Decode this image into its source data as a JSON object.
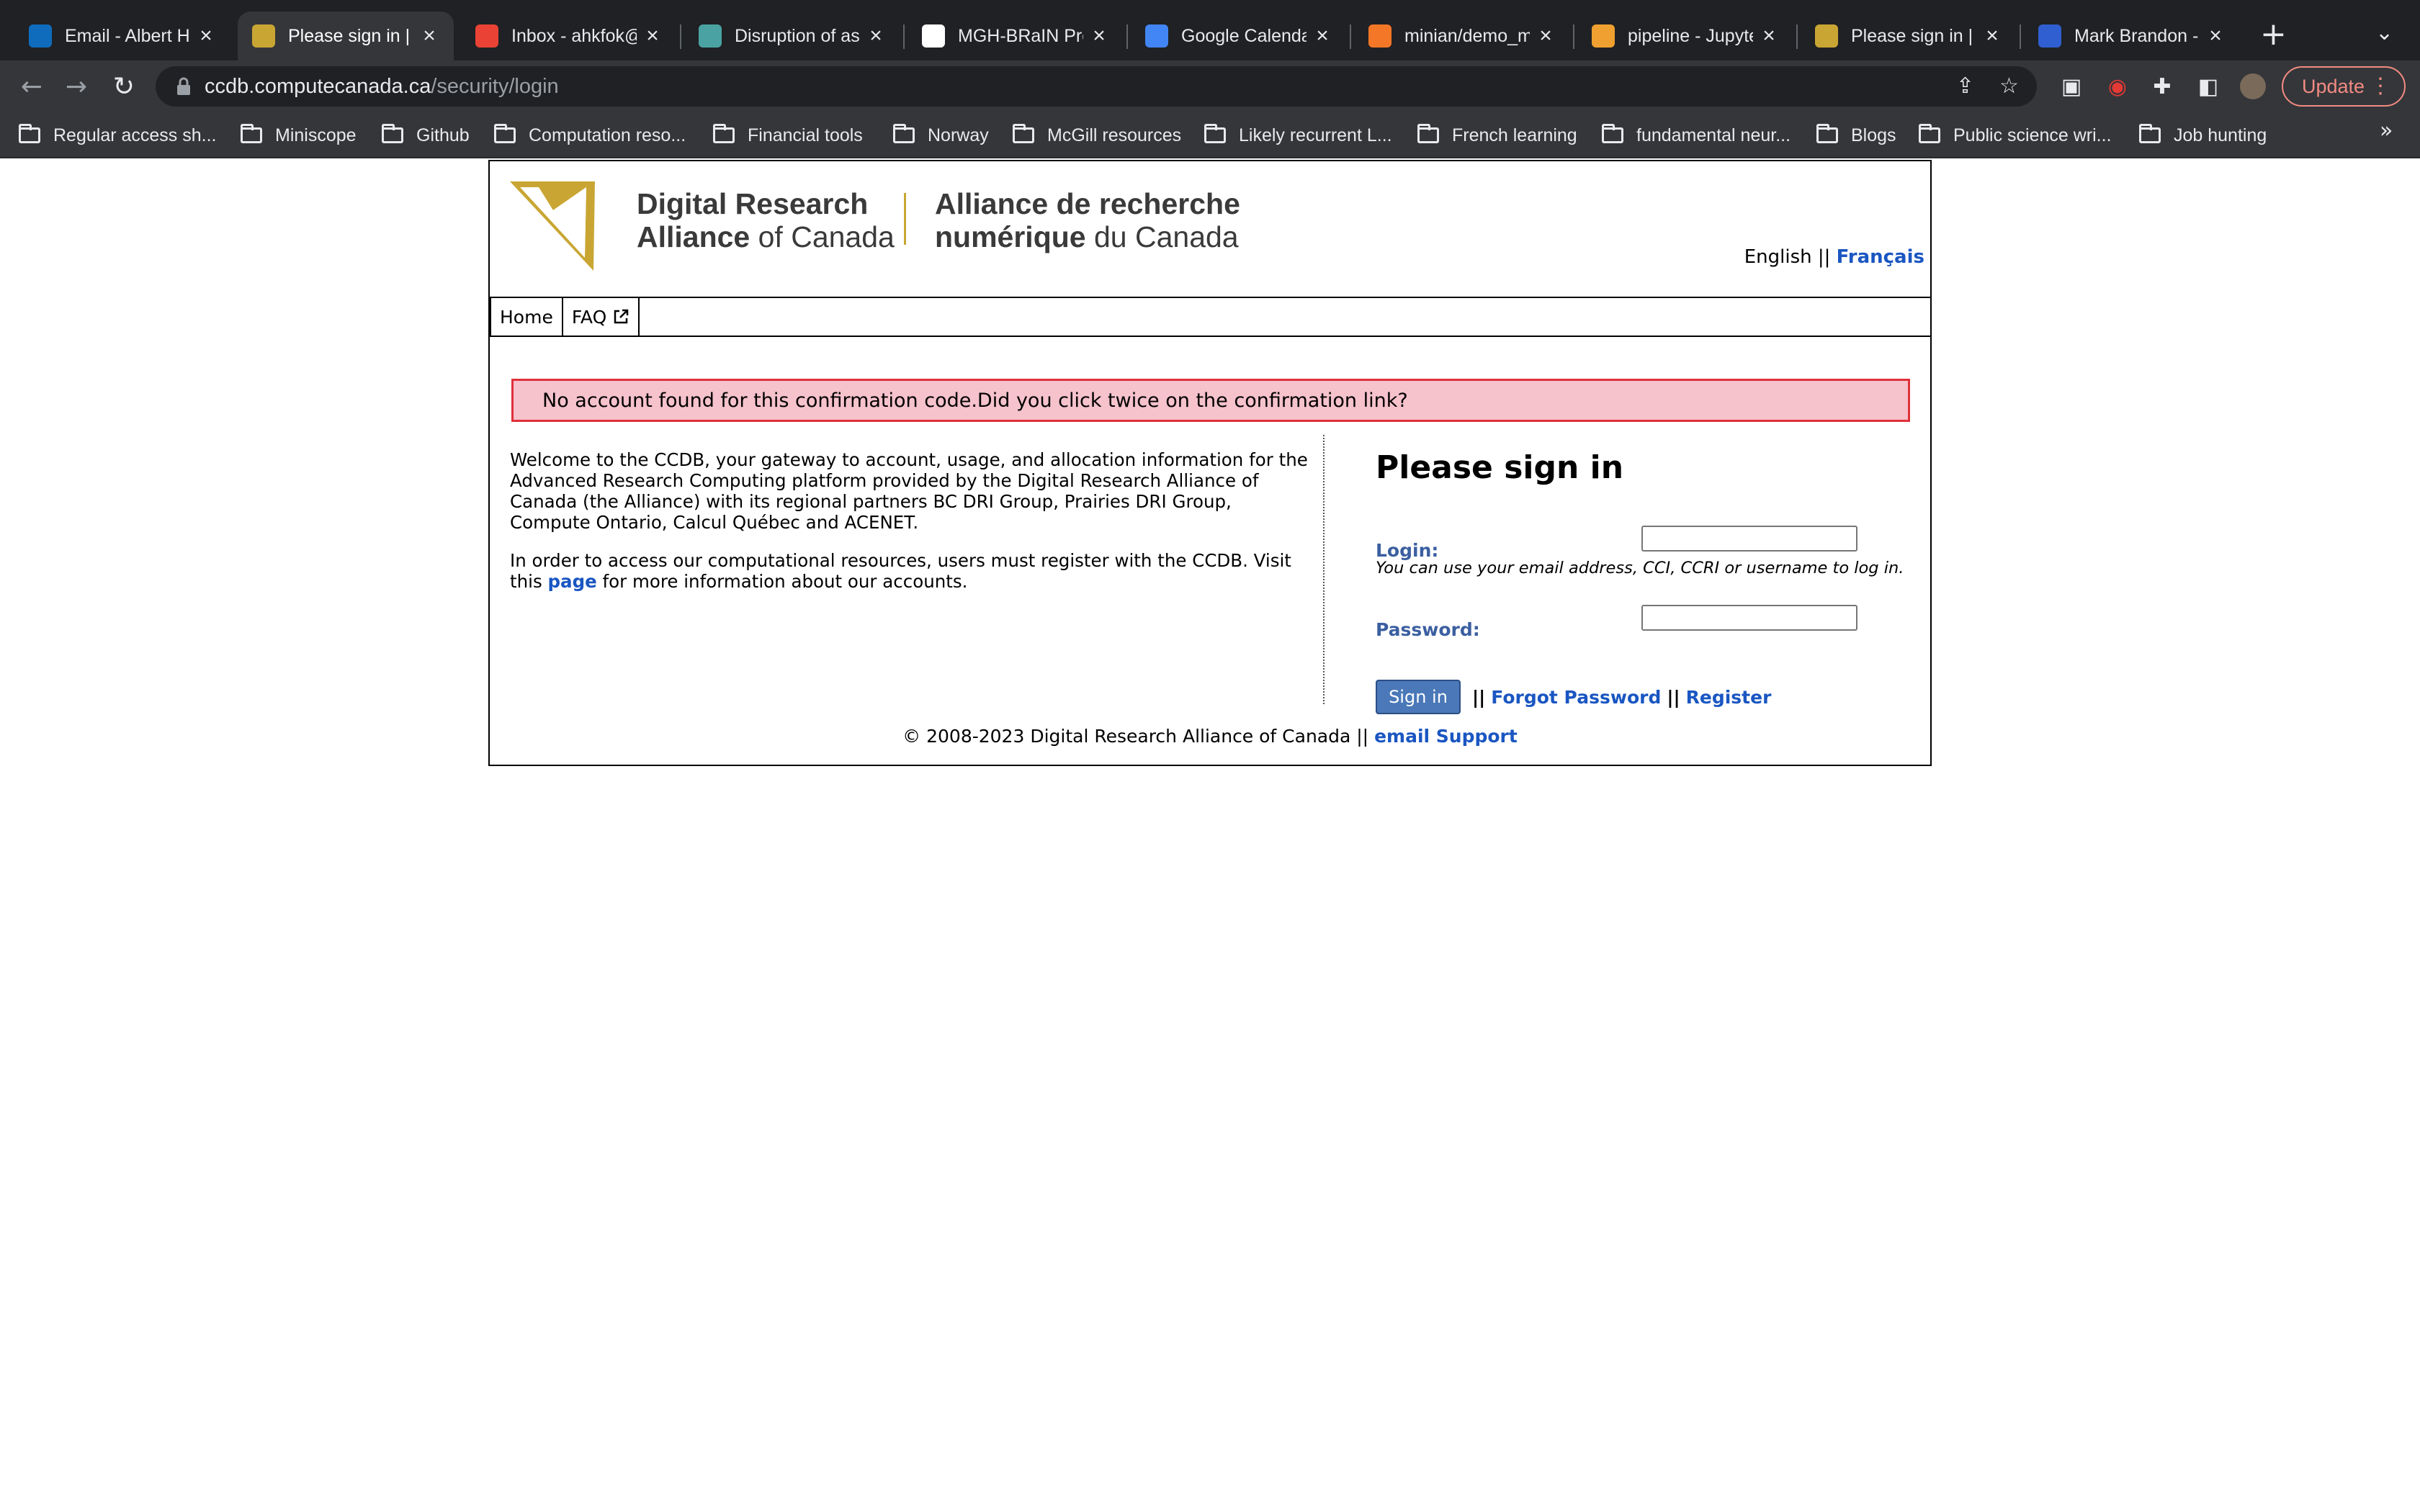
{
  "browser": {
    "tabs": [
      {
        "title": "Email - Albert H",
        "favicon": "outlook-icon",
        "color": "#0f6cbd"
      },
      {
        "title": "Please sign in | C",
        "favicon": "ccdb-icon",
        "color": "#c9a633",
        "active": true
      },
      {
        "title": "Inbox - ahkfok@",
        "favicon": "gmail-icon",
        "color": "#ea4335"
      },
      {
        "title": "Disruption of as",
        "favicon": "paper-icon",
        "color": "#4aa3a2"
      },
      {
        "title": "MGH-BRaIN Pro",
        "favicon": "sheets-icon",
        "color": "#ffffff"
      },
      {
        "title": "Google Calenda",
        "favicon": "calendar-icon",
        "color": "#4285f4"
      },
      {
        "title": "minian/demo_m",
        "favicon": "jupyter-icon",
        "color": "#f37726"
      },
      {
        "title": "pipeline - Jupyte",
        "favicon": "notebook-icon",
        "color": "#f0a030"
      },
      {
        "title": "Please sign in | C",
        "favicon": "ccdb-icon",
        "color": "#c9a633"
      },
      {
        "title": "Mark Brandon -",
        "favicon": "d-icon",
        "color": "#2f5fd0"
      }
    ],
    "url_host": "ccdb.computecanada.ca",
    "url_path": "/security/login",
    "update_label": "Update",
    "bookmarks": [
      "Regular access sh...",
      "Miniscope",
      "Github",
      "Computation reso...",
      "Financial tools",
      "Norway",
      "McGill resources",
      "Likely recurrent L...",
      "French learning",
      "fundamental neur...",
      "Blogs",
      "Public science wri...",
      "Job hunting"
    ]
  },
  "page": {
    "logo": {
      "en_line1": "Digital Research",
      "en_line2_bold": "Alliance",
      "en_line2_rest": " of Canada",
      "fr_line1": "Alliance de recherche",
      "fr_line2_bold": "numérique",
      "fr_line2_rest": " du Canada",
      "brand_color": "#c9a633"
    },
    "lang": {
      "english": "English",
      "separator": "||",
      "french": "Français"
    },
    "menu": {
      "home": "Home",
      "faq": "FAQ"
    },
    "alert": "No account found for this confirmation code.Did you click twice on the confirmation link?",
    "welcome": {
      "p1": "Welcome to the CCDB, your gateway to account, usage, and allocation information for the Advanced Research Computing platform provided by the Digital Research Alliance of Canada (the Alliance) with its regional partners BC DRI Group, Prairies DRI Group, Compute Ontario, Calcul Québec and ACENET.",
      "p2_before": "In order to access our computational resources, users must register with the CCDB. Visit this ",
      "p2_link": "page",
      "p2_after": " for more information about our accounts."
    },
    "signin": {
      "title": "Please sign in",
      "login_label": "Login:",
      "login_value": "",
      "login_hint": "You can use your email address, CCI, CCRI or username to log in.",
      "password_label": "Password:",
      "password_value": "",
      "button": "Sign in",
      "sep": "||",
      "forgot": "Forgot Password",
      "register": "Register"
    },
    "footer": {
      "text": "© 2008-2023 Digital Research Alliance of Canada || ",
      "link": "email Support"
    }
  }
}
